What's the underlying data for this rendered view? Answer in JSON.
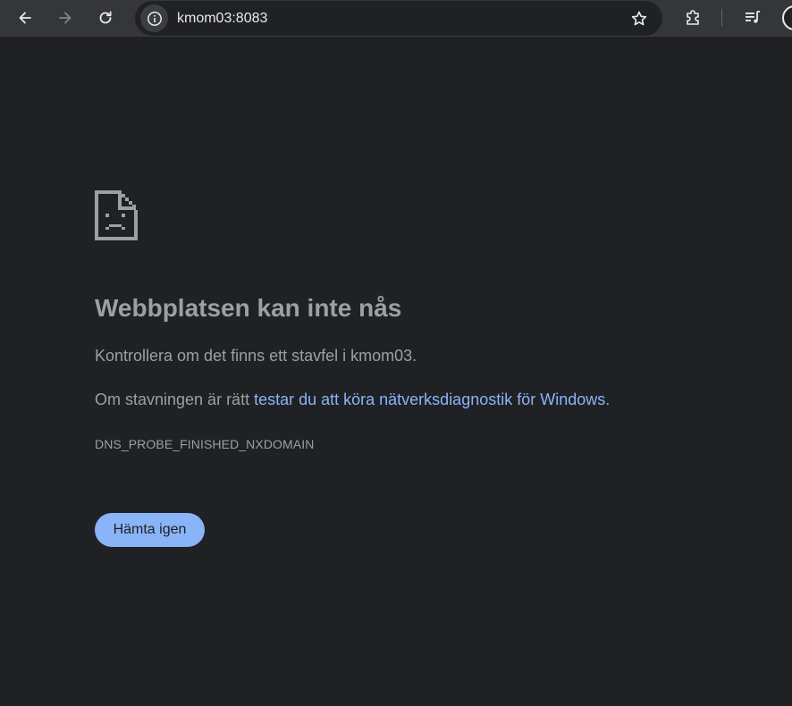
{
  "browser": {
    "address_bar": {
      "url": "kmom03:8083"
    },
    "icons": {
      "back": "back-arrow-icon",
      "forward": "forward-arrow-icon",
      "reload": "reload-icon",
      "site_info": "info-icon",
      "bookmark": "star-icon",
      "extensions": "puzzle-icon",
      "media": "media-queue-icon",
      "profile": "avatar"
    }
  },
  "error_page": {
    "icon": "sad-document-icon",
    "heading": "Webbplatsen kan inte nås",
    "line1": "Kontrollera om det finns ett stavfel i kmom03.",
    "line2_prefix": "Om stavningen är rätt ",
    "line2_link": "testar du att köra nätverksdiagnostik för Windows",
    "line2_suffix": ".",
    "error_code": "DNS_PROBE_FINISHED_NXDOMAIN",
    "reload_button": "Hämta igen"
  },
  "colors": {
    "background": "#202124",
    "toolbar": "#35363a",
    "text": "#9aa0a6",
    "link": "#8ab4f8",
    "button": "#8ab4f8"
  }
}
